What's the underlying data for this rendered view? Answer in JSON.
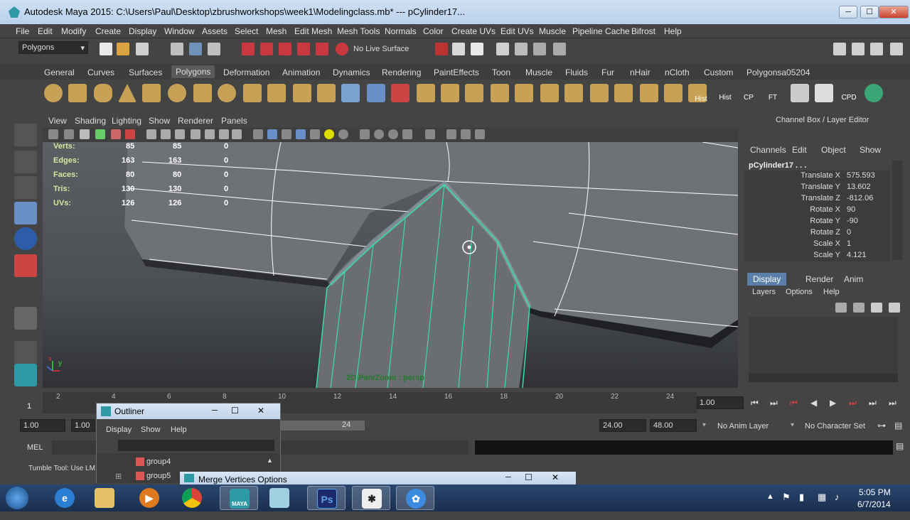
{
  "window": {
    "title": "Autodesk Maya 2015: C:\\Users\\Paul\\Desktop\\zbrushworkshops\\week1\\Modelingclass.mb*   ---   pCylinder17...",
    "minimize": "─",
    "maximize": "☐",
    "close": "✕"
  },
  "menubar": [
    "File",
    "Edit",
    "Modify",
    "Create",
    "Display",
    "Window",
    "Assets",
    "Select",
    "Mesh",
    "Edit Mesh",
    "Mesh Tools",
    "Normals",
    "Color",
    "Create UVs",
    "Edit UVs",
    "Muscle",
    "Pipeline Cache",
    "Bifrost",
    "Help"
  ],
  "statusline": {
    "menuset": "Polygons",
    "live_surface": "No Live Surface"
  },
  "shelf_tabs": [
    "General",
    "Curves",
    "Surfaces",
    "Polygons",
    "Deformation",
    "Animation",
    "Dynamics",
    "Rendering",
    "PaintEffects",
    "Toon",
    "Muscle",
    "Fluids",
    "Fur",
    "nHair",
    "nCloth",
    "Custom",
    "Polygonsa05204"
  ],
  "shelf_active_tab": "Polygons",
  "shelf_text_icons": [
    "Hist",
    "Hist",
    "CP",
    "FT",
    "CPD"
  ],
  "viewport": {
    "menu": [
      "View",
      "Shading",
      "Lighting",
      "Show",
      "Renderer",
      "Panels"
    ],
    "hud": [
      {
        "label": "Verts:",
        "a": "85",
        "b": "85",
        "c": "0"
      },
      {
        "label": "Edges:",
        "a": "163",
        "b": "163",
        "c": "0"
      },
      {
        "label": "Faces:",
        "a": "80",
        "b": "80",
        "c": "0"
      },
      {
        "label": "Tris:",
        "a": "130",
        "b": "130",
        "c": "0"
      },
      {
        "label": "UVs:",
        "a": "126",
        "b": "126",
        "c": "0"
      }
    ],
    "camera_label": "2D Pan/Zoom : persp",
    "axis_x": "x",
    "axis_y": "y"
  },
  "channel_box": {
    "header": "Channel Box / Layer Editor",
    "tabs": [
      "Channels",
      "Edit",
      "Object",
      "Show"
    ],
    "object_name": "pCylinder17 . . .",
    "attrs": [
      {
        "k": "Translate X",
        "v": "575.593"
      },
      {
        "k": "Translate Y",
        "v": "13.602"
      },
      {
        "k": "Translate Z",
        "v": "-812.06"
      },
      {
        "k": "Rotate X",
        "v": "90"
      },
      {
        "k": "Rotate Y",
        "v": "-90"
      },
      {
        "k": "Rotate Z",
        "v": "0"
      },
      {
        "k": "Scale X",
        "v": "1"
      },
      {
        "k": "Scale Y",
        "v": "4.121"
      }
    ]
  },
  "layer_editor": {
    "tabs": [
      "Display",
      "Render",
      "Anim"
    ],
    "active_tab": "Display",
    "menu": [
      "Layers",
      "Options",
      "Help"
    ]
  },
  "time_slider": {
    "ticks": [
      "2",
      "4",
      "6",
      "8",
      "10",
      "12",
      "14",
      "16",
      "18",
      "20",
      "22",
      "24"
    ],
    "current_frame": "1",
    "current_time_field": "1.00"
  },
  "range_slider": {
    "start_field": "1.00",
    "start_field2": "1.00",
    "range_end_label": "24",
    "end_field": "24.00",
    "end_field2": "48.00",
    "anim_layer": "No Anim Layer",
    "character_set": "No Character Set"
  },
  "command_line": {
    "label": "MEL"
  },
  "help_line": {
    "text": "Tumble Tool: Use LM"
  },
  "outliner": {
    "title": "Outliner",
    "menu": [
      "Display",
      "Show",
      "Help"
    ],
    "items": [
      "group4",
      "group5"
    ]
  },
  "merge_window": {
    "title": "Merge Vertices Options"
  },
  "taskbar": {
    "time": "5:05 PM",
    "date": "6/7/2014",
    "ps_label": "Ps",
    "maya_label": "MAYA"
  },
  "colors": {
    "maya_teal": "#2f9aa6",
    "wire_green": "#35e0a0",
    "ps_blue": "#1a2a6b"
  }
}
